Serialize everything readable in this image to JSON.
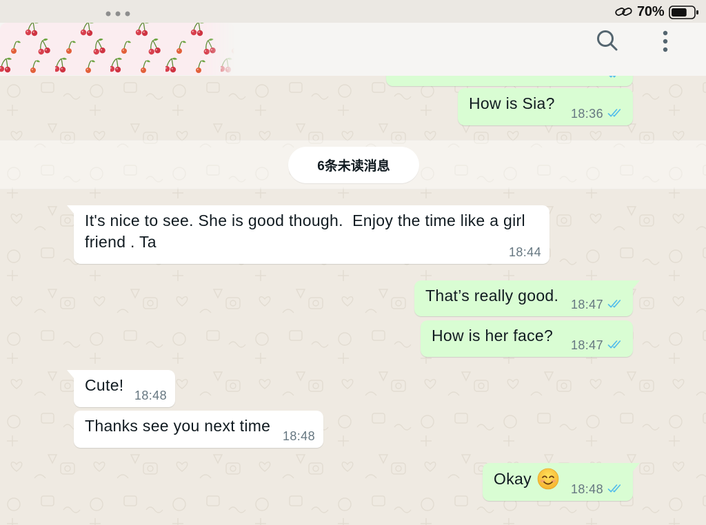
{
  "status_bar": {
    "multitask_icon": "more-horizontal-icon",
    "link_icon": "link-icon",
    "battery_text": "70%",
    "battery_icon": "battery-icon",
    "battery_level": 0.7
  },
  "header": {
    "contact_cover_icon": "cherry-pattern-sticker",
    "search_icon": "search-icon",
    "menu_icon": "more-vertical-icon"
  },
  "unread_divider": {
    "label": "6条未读消息"
  },
  "partial_message": {
    "status_icon": "read-receipt-icon"
  },
  "messages": [
    {
      "text": "How is Sia?",
      "time": "18:36",
      "status_icon": "read-receipt-icon"
    },
    {
      "text": "It's nice to see. She is good though.  Enjoy the time like a girl friend . Ta",
      "time": "18:44"
    },
    {
      "text": "That’s really good.",
      "time": "18:47",
      "status_icon": "read-receipt-icon"
    },
    {
      "text": "How is her face?",
      "time": "18:47",
      "status_icon": "read-receipt-icon"
    },
    {
      "text": "Cute!",
      "time": "18:48"
    },
    {
      "text": "Thanks see you next time",
      "time": "18:48"
    },
    {
      "text": "Okay",
      "emoji_icon": "smiling-face-with-smiling-eyes-icon",
      "time": "18:48",
      "status_icon": "read-receipt-icon"
    }
  ],
  "colors": {
    "outgoing_bubble": "#d9fdd3",
    "incoming_bubble": "#ffffff",
    "chat_background": "#efeae2",
    "read_ticks": "#53bdeb",
    "timestamp": "#667781",
    "text": "#111b21"
  }
}
